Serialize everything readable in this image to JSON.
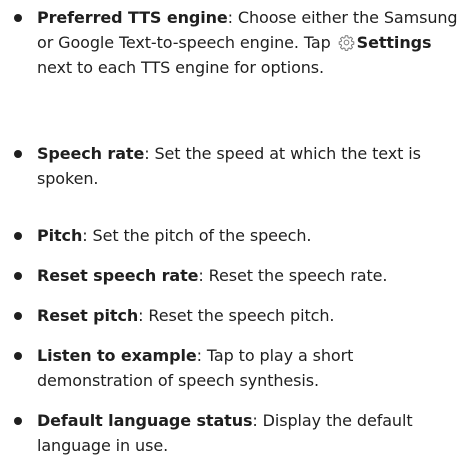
{
  "items": [
    {
      "term": "Preferred TTS engine",
      "desc_before_icon": ": Choose either the Samsung or Google Text-to-speech engine. Tap ",
      "icon": "gear-icon",
      "icon_label": "Settings",
      "desc_after_icon": " next to each TTS engine for options."
    },
    {
      "term": "Speech rate",
      "desc": ": Set the speed at which the text is spoken."
    },
    {
      "term": "Pitch",
      "desc": ": Set the pitch of the speech."
    },
    {
      "term": "Reset speech rate",
      "desc": ": Reset the speech rate."
    },
    {
      "term": "Reset pitch",
      "desc": ": Reset the speech pitch."
    },
    {
      "term": "Listen to example",
      "desc": ": Tap to play a short demonstration of speech synthesis."
    },
    {
      "term": "Default language status",
      "desc": ": Display the default language in use."
    }
  ]
}
